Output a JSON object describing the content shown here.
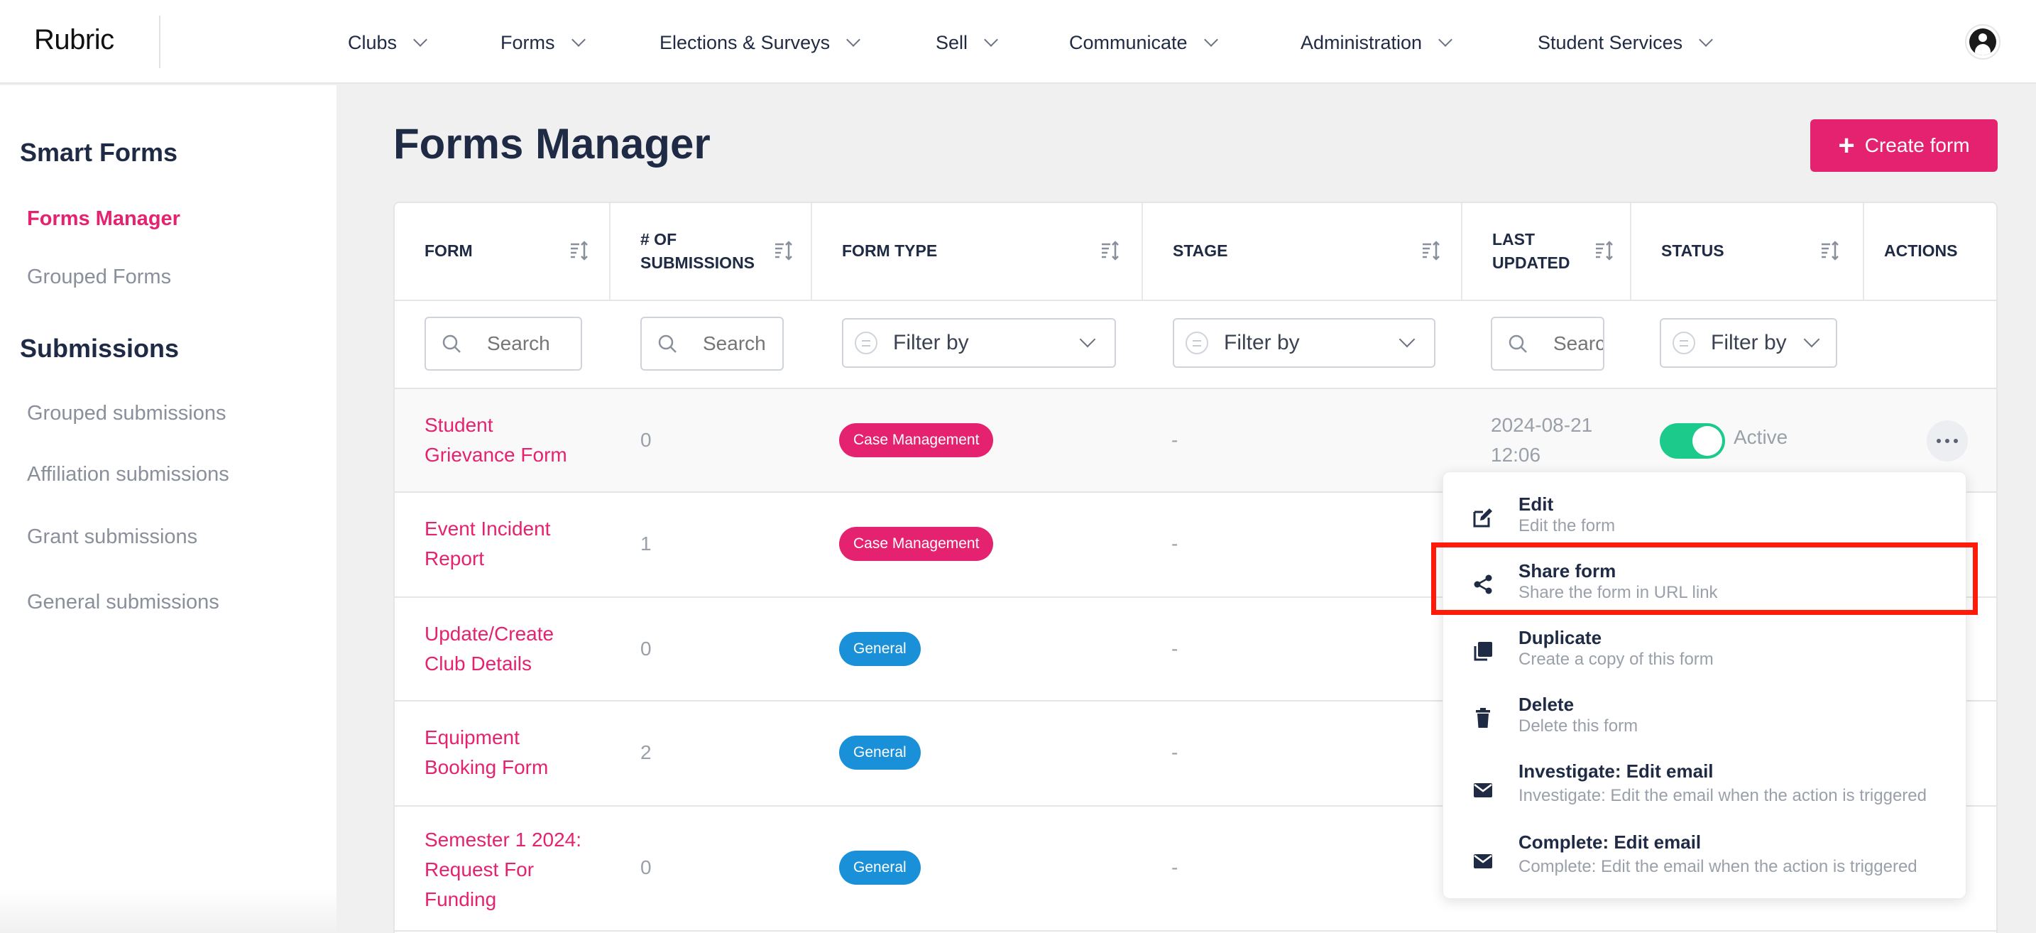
{
  "app": {
    "logo": "Rubric"
  },
  "nav": [
    {
      "label": "Clubs"
    },
    {
      "label": "Forms"
    },
    {
      "label": "Elections & Surveys"
    },
    {
      "label": "Sell"
    },
    {
      "label": "Communicate"
    },
    {
      "label": "Administration"
    },
    {
      "label": "Student Services"
    }
  ],
  "sidebar": {
    "smart_forms_heading": "Smart Forms",
    "forms_manager": "Forms Manager",
    "grouped_forms": "Grouped Forms",
    "submissions_heading": "Submissions",
    "grouped_submissions": "Grouped submissions",
    "affiliation_submissions": "Affiliation submissions",
    "grant_submissions": "Grant submissions",
    "general_submissions": "General submissions"
  },
  "main": {
    "title": "Forms Manager",
    "create_button": "Create form"
  },
  "table": {
    "headers": {
      "form": "FORM",
      "submissions_1": "# OF",
      "submissions_2": "SUBMISSIONS",
      "form_type": "FORM TYPE",
      "stage": "STAGE",
      "updated_1": "LAST",
      "updated_2": "UPDATED",
      "status": "STATUS",
      "actions": "ACTIONS"
    },
    "filters": {
      "form_search_placeholder": "Search",
      "submissions_search_placeholder": "Search",
      "form_type_filter": "Filter by",
      "stage_filter": "Filter by",
      "updated_search_placeholder": "Search",
      "status_filter": "Filter by"
    },
    "rows": [
      {
        "name_1": "Student",
        "name_2": "Grievance Form",
        "name_3": "",
        "submissions": "0",
        "type": "Case Management",
        "stage": "-",
        "date": "2024-08-21",
        "time": "12:06",
        "status": "Active"
      },
      {
        "name_1": "Event Incident",
        "name_2": "Report",
        "name_3": "",
        "submissions": "1",
        "type": "Case Management",
        "stage": "-"
      },
      {
        "name_1": "Update/Create",
        "name_2": "Club Details",
        "name_3": "",
        "submissions": "0",
        "type": "General",
        "stage": "-"
      },
      {
        "name_1": "Equipment",
        "name_2": "Booking Form",
        "name_3": "",
        "submissions": "2",
        "type": "General",
        "stage": "-"
      },
      {
        "name_1": "Semester 1 2024:",
        "name_2": "Request For",
        "name_3": "Funding",
        "submissions": "0",
        "type": "General",
        "stage": "-"
      }
    ]
  },
  "action_menu": {
    "items": [
      {
        "title": "Edit",
        "desc": "Edit the form",
        "icon": "edit-icon"
      },
      {
        "title": "Share form",
        "desc": "Share the form in URL link",
        "icon": "share-icon"
      },
      {
        "title": "Duplicate",
        "desc": "Create a copy of this form",
        "icon": "duplicate-icon"
      },
      {
        "title": "Delete",
        "desc": "Delete this form",
        "icon": "trash-icon"
      },
      {
        "title": "Investigate: Edit email",
        "desc": "Investigate: Edit the email when the action is triggered",
        "icon": "mail-icon"
      },
      {
        "title": "Complete: Edit email",
        "desc": "Complete: Edit the email when the action is triggered",
        "icon": "mail-icon"
      }
    ]
  },
  "colors": {
    "brand_pink": "#e5226f",
    "general_blue": "#1a90d8",
    "active_green": "#1ccb8c",
    "highlight_red": "#ff1a0a",
    "navy_text": "#1f2a44"
  }
}
